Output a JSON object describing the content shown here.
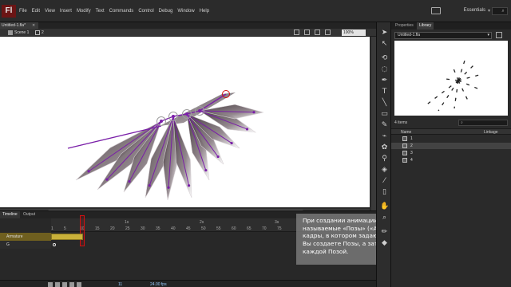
{
  "app": {
    "logo": "Fl",
    "menu": [
      "File",
      "Edit",
      "View",
      "Insert",
      "Modify",
      "Text",
      "Commands",
      "Control",
      "Debug",
      "Window",
      "Help"
    ],
    "workspace": "Essentials"
  },
  "document": {
    "tab_title": "Untitled-1.fla*",
    "scene_label": "Scene 1",
    "armature_label": "2",
    "zoom": "100%"
  },
  "timeline": {
    "tabs": [
      "Timeline",
      "Output"
    ],
    "ruler_seconds": [
      "1s",
      "2s",
      "3s"
    ],
    "ruler_frames": [
      "1",
      "5",
      "10",
      "15",
      "20",
      "25",
      "30",
      "35",
      "40",
      "45",
      "50",
      "55",
      "60",
      "65",
      "70",
      "75"
    ],
    "layers": [
      {
        "name": "Armature"
      },
      {
        "name": "G"
      }
    ],
    "current_frame": "11",
    "fps": "24.00 fps",
    "elapsed": "0.4s"
  },
  "caption": {
    "text": "При создании анимации каркасных фигур используют так называемые «Позы» («Armature»). Позы — это ключевые кадры, в котором задаются изменения в анимации. Вначале Вы создаете Позы, а затем анимируете изменения между каждой Позой."
  },
  "panel": {
    "tabs": [
      "Properties",
      "Library"
    ],
    "library_select": "Untitled-1.fla",
    "items_count": "4 items",
    "col_name": "Name",
    "col_linkage": "Linkage",
    "items": [
      "1",
      "2",
      "3",
      "4"
    ]
  },
  "colors": {
    "bone": "#7a1fa8",
    "accent_red": "#d01010",
    "pose_span": "#c9b13a"
  }
}
